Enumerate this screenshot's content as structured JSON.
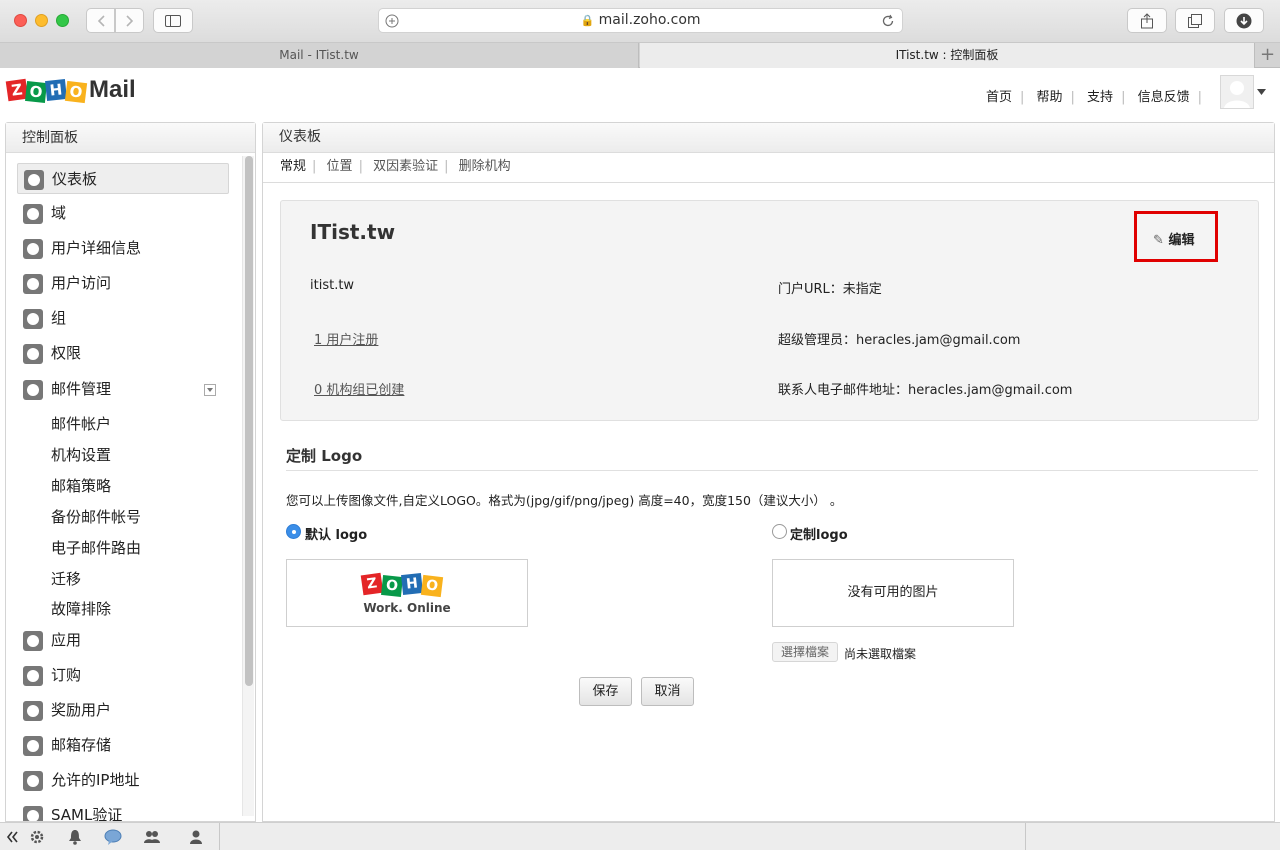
{
  "browser": {
    "url": "mail.zoho.com",
    "tabs": [
      {
        "label": "Mail - ITist.tw",
        "active": false
      },
      {
        "label": "ITist.tw : 控制面板",
        "active": true
      }
    ],
    "new_tab": "+"
  },
  "app": {
    "logo_text": "Mail",
    "logo_letters": [
      "Z",
      "O",
      "H",
      "O"
    ],
    "toplinks": [
      "首页",
      "帮助",
      "支持",
      "信息反馈"
    ]
  },
  "sidebar": {
    "title": "控制面板",
    "items": [
      {
        "label": "仪表板",
        "icon": "dashboard-icon"
      },
      {
        "label": "域",
        "icon": "globe-icon"
      },
      {
        "label": "用户详细信息",
        "icon": "user-icon"
      },
      {
        "label": "用户访问",
        "icon": "user-access-icon"
      },
      {
        "label": "组",
        "icon": "group-icon"
      },
      {
        "label": "权限",
        "icon": "permission-icon"
      },
      {
        "label": "邮件管理",
        "icon": "mail-icon"
      }
    ],
    "subitems": [
      "邮件帐户",
      "机构设置",
      "邮箱策略",
      "备份邮件帐号",
      "电子邮件路由",
      "迁移",
      "故障排除"
    ],
    "items2": [
      {
        "label": "应用",
        "icon": "app-icon"
      },
      {
        "label": "订购",
        "icon": "dollar-icon"
      },
      {
        "label": "奖励用户",
        "icon": "reward-icon"
      },
      {
        "label": "邮箱存储",
        "icon": "storage-icon"
      },
      {
        "label": "允许的IP地址",
        "icon": "ip-icon"
      },
      {
        "label": "SAML验证",
        "icon": "saml-icon"
      }
    ]
  },
  "main": {
    "title": "仪表板",
    "subtabs": [
      "常规",
      "位置",
      "双因素验证",
      "删除机构"
    ],
    "org_name": "ITist.tw",
    "edit_label": "编辑",
    "domain": "itist.tw",
    "portal": "门户URL：未指定",
    "users_link": "1 用户注册",
    "super_admin": "超级管理员：heracles.jam@gmail.com",
    "groups_link": "0 机构组已创建",
    "contact": "联系人电子邮件地址：heracles.jam@gmail.com",
    "logo_section_title": "定制 Logo",
    "logo_desc": "您可以上传图像文件,自定义LOGO。格式为(jpg/gif/png/jpeg) 高度=40，宽度150（建议大小） 。",
    "default_logo_label": "默认 logo",
    "custom_logo_label": "定制logo",
    "default_logo_caption": "Work. Online",
    "no_image": "没有可用的图片",
    "choose_file": "選擇檔案",
    "no_file": "尚未選取檔案",
    "save": "保存",
    "cancel": "取消"
  },
  "colors": {
    "accent": "#3b8ee8",
    "highlight": "#e00000",
    "zoho_red": "#e42527",
    "zoho_green": "#089949",
    "zoho_blue": "#226db4",
    "zoho_yellow": "#f9b21d"
  }
}
